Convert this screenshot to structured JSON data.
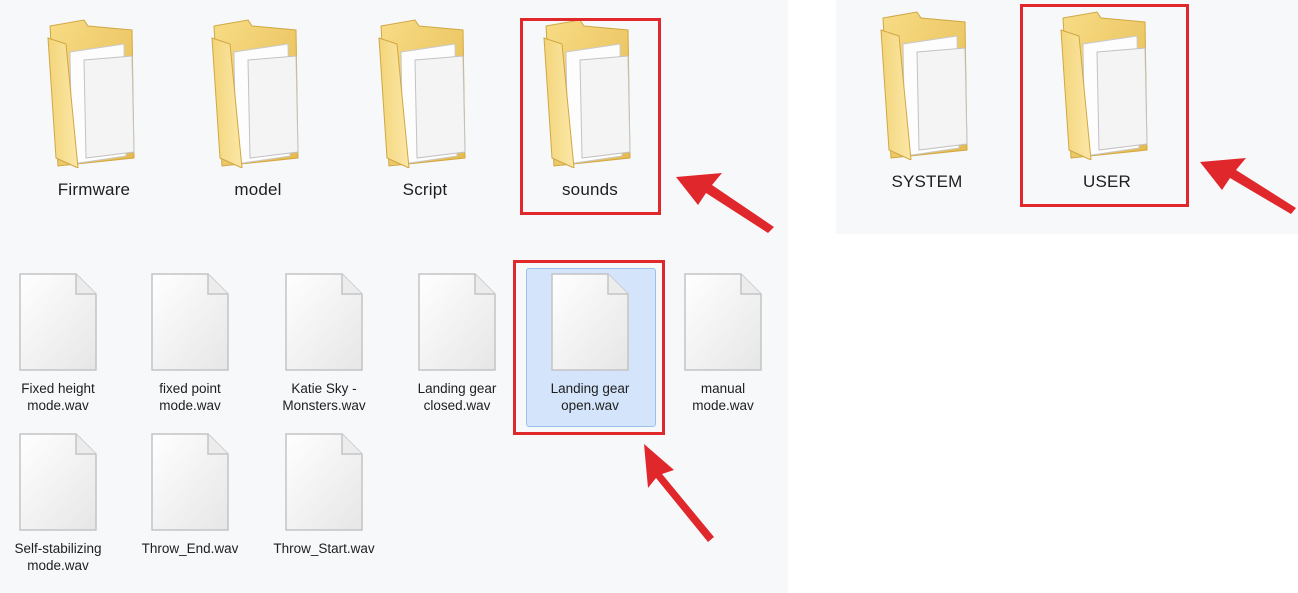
{
  "root_folders": [
    {
      "label": "Firmware",
      "icon": "folder-icon"
    },
    {
      "label": "model",
      "icon": "folder-icon"
    },
    {
      "label": "Script",
      "icon": "folder-icon"
    },
    {
      "label": "sounds",
      "icon": "folder-icon",
      "highlighted": true
    }
  ],
  "drive_folders": [
    {
      "label": "SYSTEM",
      "icon": "folder-icon"
    },
    {
      "label": "USER",
      "icon": "folder-icon",
      "highlighted": true
    }
  ],
  "sound_files": [
    {
      "label": "Fixed height\nmode.wav",
      "icon": "file-icon"
    },
    {
      "label": "fixed point\nmode.wav",
      "icon": "file-icon"
    },
    {
      "label": "Katie Sky -\nMonsters.wav",
      "icon": "file-icon"
    },
    {
      "label": "Landing gear\nclosed.wav",
      "icon": "file-icon"
    },
    {
      "label": "Landing gear\nopen.wav",
      "icon": "file-icon",
      "selected": true,
      "highlighted": true
    },
    {
      "label": "manual\nmode.wav",
      "icon": "file-icon"
    },
    {
      "label": "Self-stabilizing\nmode.wav",
      "icon": "file-icon"
    },
    {
      "label": "Throw_End.wav",
      "icon": "file-icon"
    },
    {
      "label": "Throw_Start.wav",
      "icon": "file-icon"
    }
  ],
  "colors": {
    "highlight_box": "#e0282c",
    "selection_fill": "#d3e4fb",
    "folder_fill": "#f2cf72"
  }
}
